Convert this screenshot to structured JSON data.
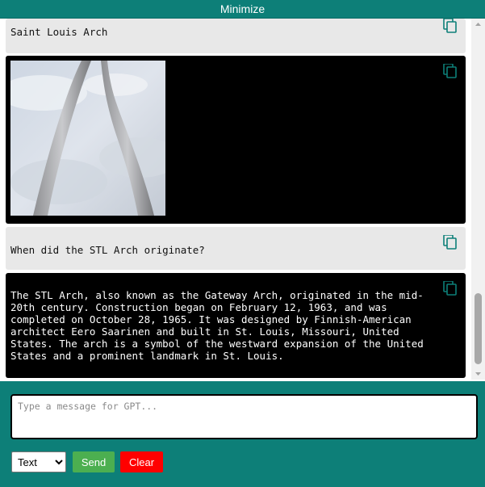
{
  "header": {
    "minimize_label": "Minimize"
  },
  "colors": {
    "accent": "#0d7f78",
    "send_button": "#4caf50",
    "clear_button": "#ff0000",
    "copy_icon": "#0d7f78"
  },
  "messages": [
    {
      "role": "user",
      "kind": "text",
      "text": "Saint Louis Arch"
    },
    {
      "role": "assistant",
      "kind": "image",
      "image_subject": "Gateway Arch against cloudy sky"
    },
    {
      "role": "user",
      "kind": "text",
      "text": "When did the STL Arch originate?"
    },
    {
      "role": "assistant",
      "kind": "text",
      "text": "The STL Arch, also known as the Gateway Arch, originated in the mid-20th century. Construction began on February 12, 1963, and was completed on October 28, 1965. It was designed by Finnish-American architect Eero Saarinen and built in St. Louis, Missouri, United States. The arch is a symbol of the westward expansion of the United States and a prominent landmark in St. Louis."
    }
  ],
  "icons": {
    "copy": "copy-icon"
  },
  "composer": {
    "placeholder": "Type a message for GPT...",
    "value": "",
    "mode_selected": "Text",
    "send_label": "Send",
    "clear_label": "Clear"
  }
}
